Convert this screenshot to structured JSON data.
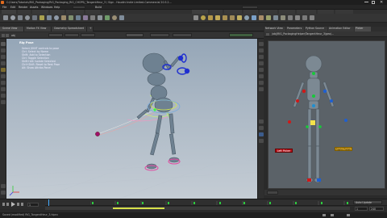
{
  "window": {
    "title": "C:/Users/Tutorials/RiG_Packaging/RiG_Packaging_RiG_CHOPS/_TangentHeur_3 / Sign - Houdini Indie Limited-Commercial 20.5.2..."
  },
  "menubar": {
    "items": [
      "File",
      "Edit",
      "Render",
      "Assets",
      "Windows",
      "Help"
    ],
    "build": "Build"
  },
  "viewport_panel": {
    "tabs": [
      "Scene View",
      "Motion FX View",
      "Geometry Spreadsheet",
      "+"
    ],
    "path": "obj"
  },
  "rig_tool": {
    "title": "Rig Pose",
    "lines": [
      "Select JOINT controls to pose",
      "Ctrl: Select by Name",
      "Shift: Add to Selection",
      "Ctrl: Toggle Selection",
      "Shift+Alt: Isolate Selected",
      "Ctrl+Shift: Reset to Rest Pose",
      "Alt: Show Attribs Panel"
    ]
  },
  "right_panel": {
    "tabs": [
      "Network View",
      "Parameters",
      "Python Source",
      "Animation Editor",
      "Picker"
    ],
    "path": "/obj/RIG_PackagingHelper/TangentHeur_3/geo/...",
    "labels": {
      "left": "Left Picker",
      "right": "Right Picker"
    }
  },
  "timeline": {
    "frame": "1",
    "start": "1",
    "end": "240",
    "auto_key": "Auto Update"
  },
  "status": {
    "text": "Saved (modified) RiG_TangentHeur_3.hipnc"
  },
  "colors": {
    "viewport_top": "#95a6b7",
    "viewport_bottom": "#c4ccd4",
    "control_blue": "#1f2fd0",
    "control_green": "#17c93a",
    "control_red": "#d01818",
    "label_red": "#b3121a",
    "label_yellow": "#d9a41a"
  }
}
